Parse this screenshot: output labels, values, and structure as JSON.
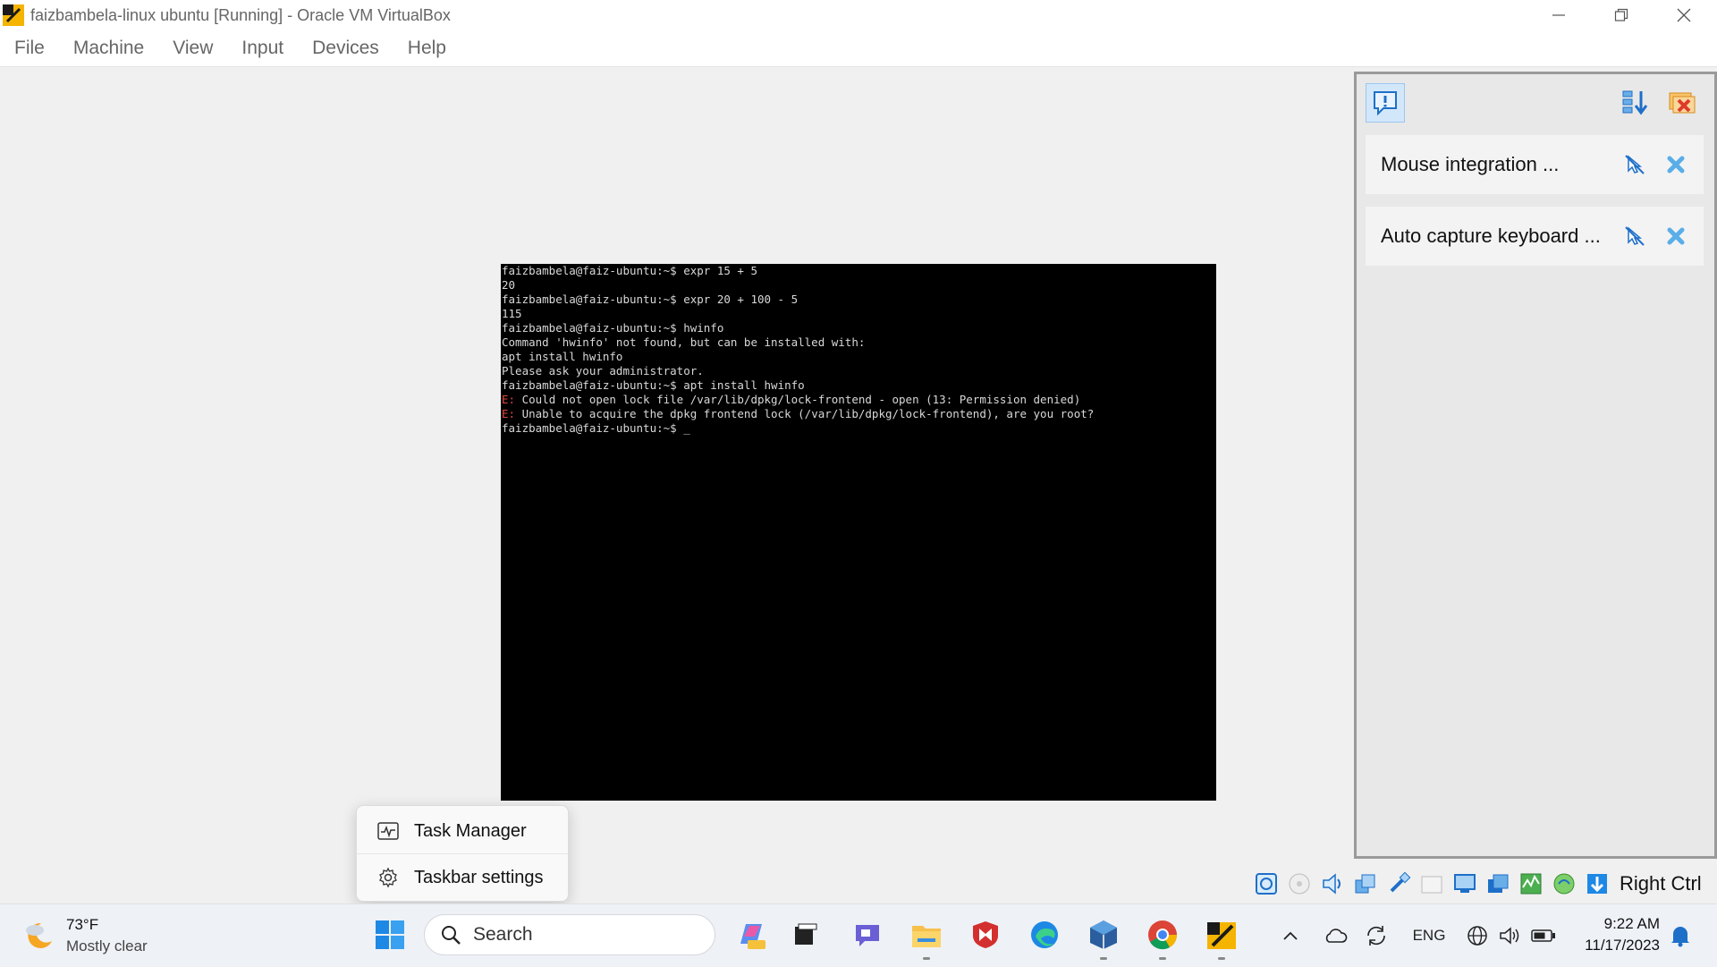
{
  "window": {
    "title": "faizbambela-linux ubuntu [Running] - Oracle VM VirtualBox"
  },
  "menu": [
    "File",
    "Machine",
    "View",
    "Input",
    "Devices",
    "Help"
  ],
  "terminal": {
    "lines": [
      {
        "text": "faizbambela@faiz-ubuntu:~$ expr 15 + 5",
        "error": false
      },
      {
        "text": "20",
        "error": false
      },
      {
        "text": "faizbambela@faiz-ubuntu:~$ expr 20 + 100 - 5",
        "error": false
      },
      {
        "text": "115",
        "error": false
      },
      {
        "text": "faizbambela@faiz-ubuntu:~$ hwinfo",
        "error": false
      },
      {
        "text": "Command 'hwinfo' not found, but can be installed with:",
        "error": false
      },
      {
        "text": "apt install hwinfo",
        "error": false
      },
      {
        "text": "Please ask your administrator.",
        "error": false
      },
      {
        "text": "faizbambela@faiz-ubuntu:~$ apt install hwinfo",
        "error": false
      },
      {
        "prefix": "E:",
        "text": " Could not open lock file /var/lib/dpkg/lock-frontend - open (13: Permission denied)",
        "error": true
      },
      {
        "prefix": "E:",
        "text": " Unable to acquire the dpkg frontend lock (/var/lib/dpkg/lock-frontend), are you root?",
        "error": true
      },
      {
        "text": "faizbambela@faiz-ubuntu:~$ _",
        "error": false
      }
    ]
  },
  "notifications": {
    "items": [
      {
        "label": "Mouse integration ..."
      },
      {
        "label": "Auto capture keyboard ..."
      }
    ]
  },
  "statusbar": {
    "host_key": "Right Ctrl"
  },
  "context_menu": {
    "items": [
      {
        "label": "Task Manager",
        "icon": "task-manager-icon"
      },
      {
        "label": "Taskbar settings",
        "icon": "gear-icon"
      }
    ]
  },
  "taskbar": {
    "weather": {
      "temp": "73°F",
      "condition": "Mostly clear"
    },
    "search_placeholder": "Search",
    "language": "ENG",
    "time": "9:22 AM",
    "date": "11/17/2023"
  },
  "colors": {
    "terminal_bg": "#000000",
    "terminal_fg": "#d8d8d8",
    "error_red": "#e0483a",
    "accent_blue": "#1e88e5",
    "taskbar_bg": "#eef1f6"
  }
}
